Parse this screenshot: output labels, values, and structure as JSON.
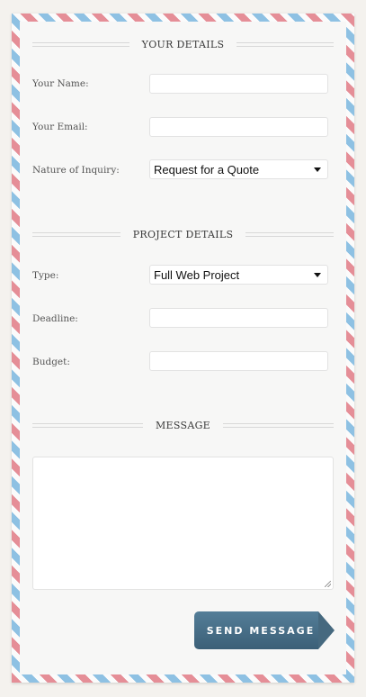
{
  "sections": {
    "your_details": "YOUR DETAILS",
    "project_details": "PROJECT DETAILS",
    "message": "MESSAGE"
  },
  "fields": {
    "name": {
      "label": "Your Name:",
      "value": ""
    },
    "email": {
      "label": "Your Email:",
      "value": ""
    },
    "inquiry": {
      "label": "Nature of Inquiry:",
      "selected": "Request for a Quote"
    },
    "type": {
      "label": "Type:",
      "selected": "Full Web Project"
    },
    "deadline": {
      "label": "Deadline:",
      "value": ""
    },
    "budget": {
      "label": "Budget:",
      "value": ""
    },
    "message": {
      "value": ""
    }
  },
  "send_button": {
    "label": "SEND MESSAGE"
  },
  "colors": {
    "stripe_red": "#e58e97",
    "stripe_blue": "#8ec1e3",
    "button": "#46697f"
  }
}
